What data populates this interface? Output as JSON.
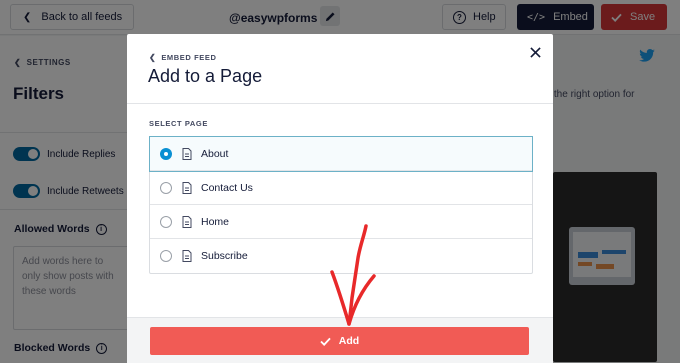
{
  "topbar": {
    "back_label": "Back to all feeds",
    "handle": "@easywpforms",
    "help_label": "Help",
    "embed_label": "Embed",
    "save_label": "Save"
  },
  "left_panel": {
    "crumb": "SETTINGS",
    "title": "Filters",
    "toggles": [
      {
        "label": "Include Replies",
        "on": true
      },
      {
        "label": "Include Retweets",
        "on": true
      }
    ],
    "allowed_words_label": "Allowed Words",
    "allowed_words_placeholder": "Add words here to only show posts with these words",
    "blocked_words_label": "Blocked Words"
  },
  "right_area": {
    "hint": "nd the right option for"
  },
  "modal": {
    "crumb": "EMBED FEED",
    "title": "Add to a Page",
    "select_label": "SELECT PAGE",
    "pages": [
      {
        "label": "About",
        "selected": true
      },
      {
        "label": "Contact Us",
        "selected": false
      },
      {
        "label": "Home",
        "selected": false
      },
      {
        "label": "Subscribe",
        "selected": false
      }
    ],
    "add_label": "Add"
  },
  "colors": {
    "accent": "#0068a0",
    "radio_selected": "#0a90d3",
    "add_button": "#f15b55",
    "save_button": "#d63638",
    "annotation_arrow": "#e8292a"
  },
  "icons": [
    "chevron-left-icon",
    "pencil-icon",
    "help-icon",
    "code-icon",
    "check-icon",
    "info-icon",
    "twitter-icon",
    "close-icon",
    "document-icon"
  ]
}
